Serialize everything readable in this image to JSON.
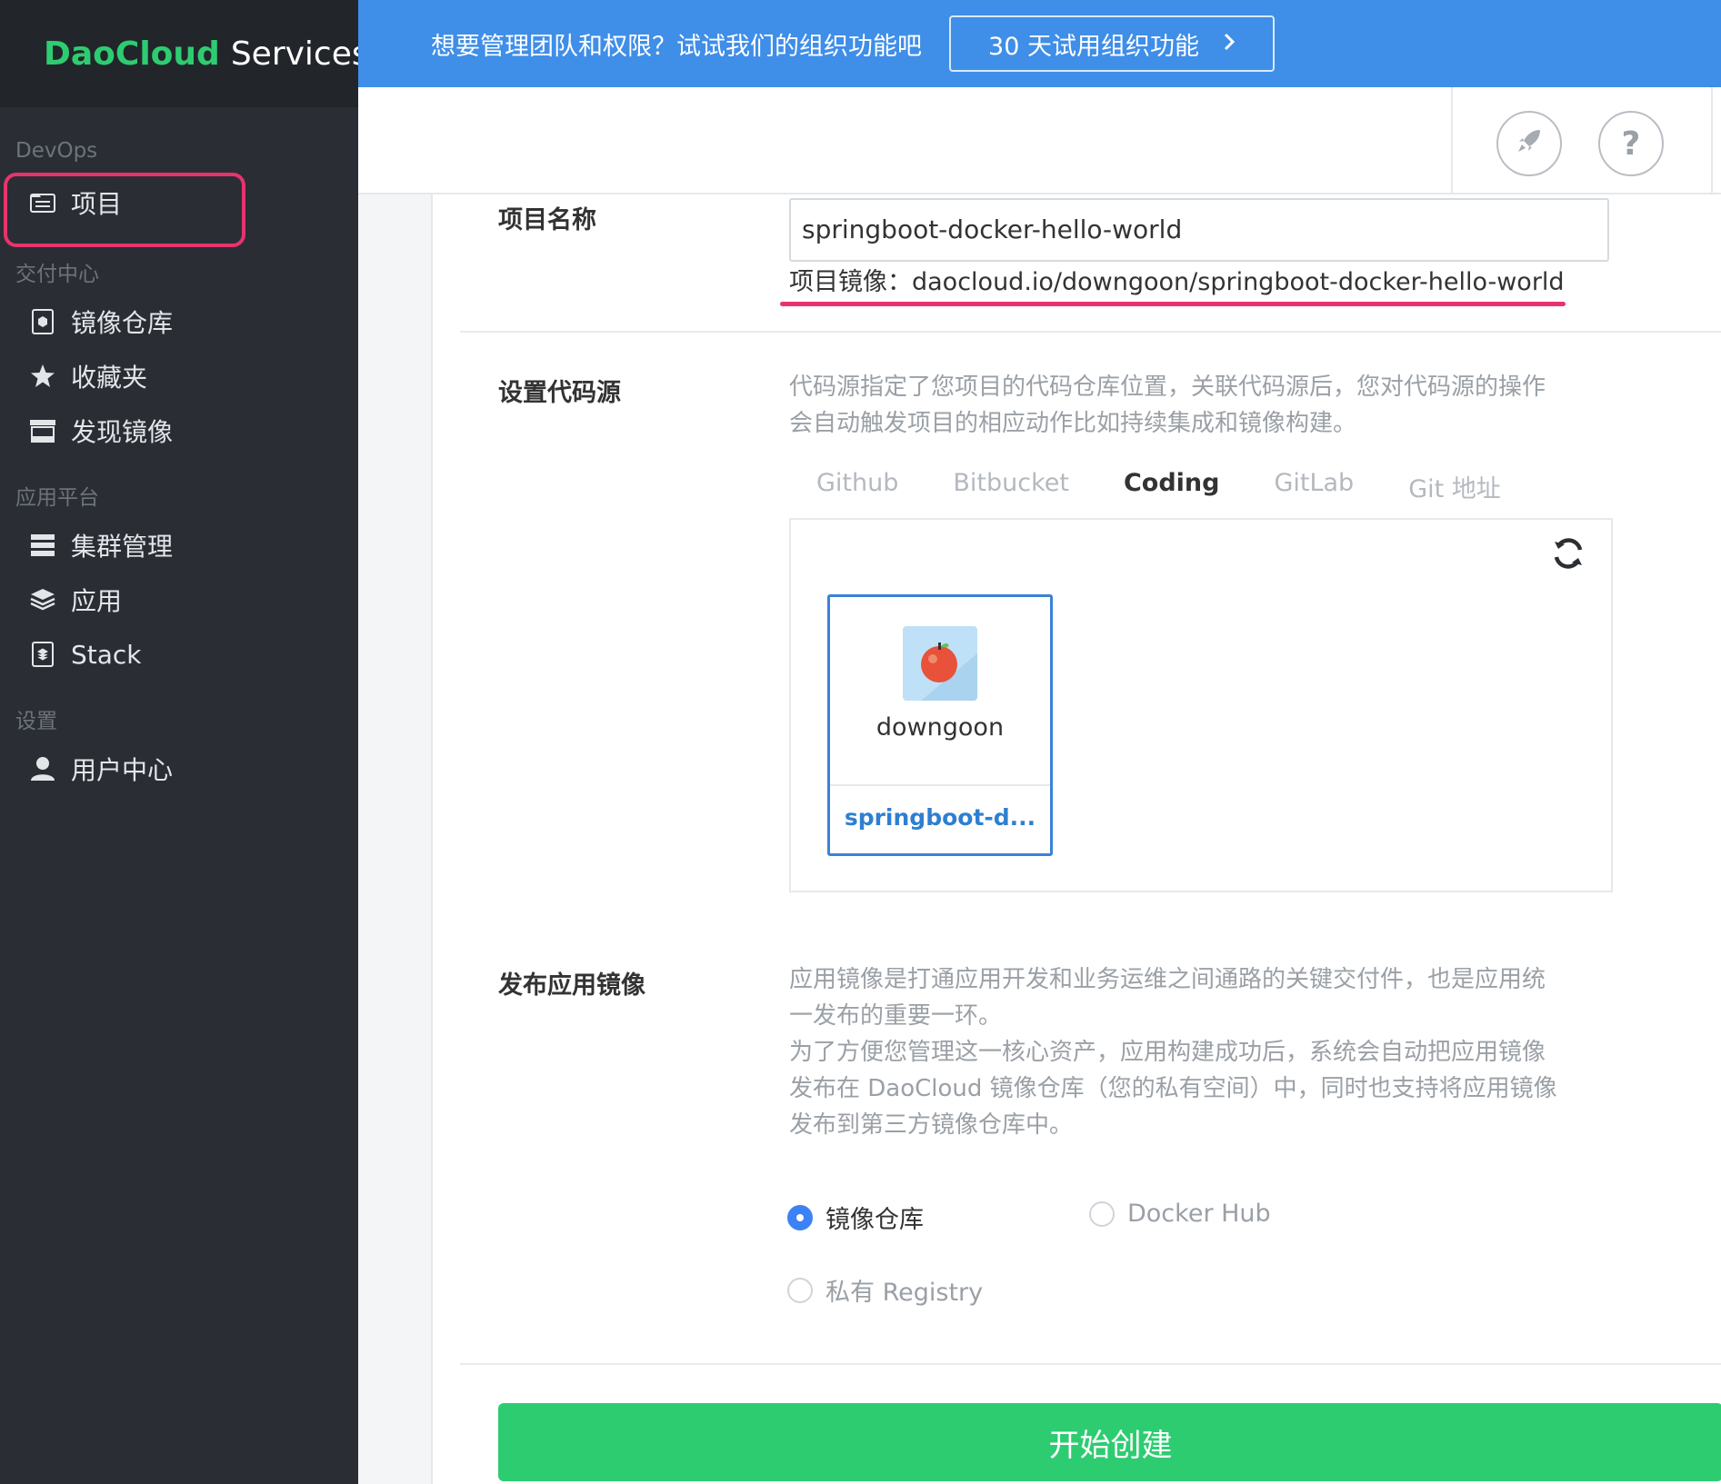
{
  "sidebar": {
    "brand": "DaoCloud",
    "brand_suffix": "Services",
    "groups": [
      {
        "title": "DevOps",
        "items": [
          {
            "label": "项目",
            "icon": "folder-list-icon"
          }
        ]
      },
      {
        "title": "交付中心",
        "items": [
          {
            "label": "镜像仓库",
            "icon": "package-icon"
          },
          {
            "label": "收藏夹",
            "icon": "star-icon"
          },
          {
            "label": "发现镜像",
            "icon": "store-icon"
          }
        ]
      },
      {
        "title": "应用平台",
        "items": [
          {
            "label": "集群管理",
            "icon": "server-icon"
          },
          {
            "label": "应用",
            "icon": "layers-icon"
          },
          {
            "label": "Stack",
            "icon": "stack-file-icon"
          }
        ]
      },
      {
        "title": "设置",
        "items": [
          {
            "label": "用户中心",
            "icon": "user-icon"
          }
        ]
      }
    ]
  },
  "promo": {
    "text": "想要管理团队和权限？试试我们的组织功能吧",
    "button": "30 天试用组织功能"
  },
  "header": {
    "rocket_icon": "rocket-icon",
    "help_label": "?"
  },
  "form": {
    "name_label": "项目名称",
    "name_value": "springboot-docker-hello-world",
    "image_prefix": "项目镜像：",
    "image_value": "daocloud.io/downgoon/springboot-docker-hello-world",
    "source_label": "设置代码源",
    "source_desc_1": "代码源指定了您项目的代码仓库位置，关联代码源后，您对代码源的操作",
    "source_desc_2": "会自动触发项目的相应动作比如持续集成和镜像构建。",
    "tabs": [
      "Github",
      "Bitbucket",
      "Coding",
      "GitLab",
      "Git 地址"
    ],
    "active_tab": "Coding",
    "repo_owner": "downgoon",
    "repo_name": "springboot-d...",
    "publish_label": "发布应用镜像",
    "publish_desc": [
      "应用镜像是打通应用开发和业务运维之间通路的关键交付件，也是应用统",
      "一发布的重要一环。",
      "为了方便您管理这一核心资产，应用构建成功后，系统会自动把应用镜像",
      "发布在 DaoCloud 镜像仓库（您的私有空间）中，同时也支持将应用镜像",
      "发布到第三方镜像仓库中。"
    ],
    "radio_options": [
      "镜像仓库",
      "Docker Hub",
      "私有 Registry"
    ],
    "radio_selected": "镜像仓库",
    "submit": "开始创建"
  },
  "colors": {
    "brand_green": "#2ecc71",
    "promo_blue": "#3f8ee8",
    "highlight_pink": "#e8336d",
    "link_blue": "#2f7fd0"
  }
}
